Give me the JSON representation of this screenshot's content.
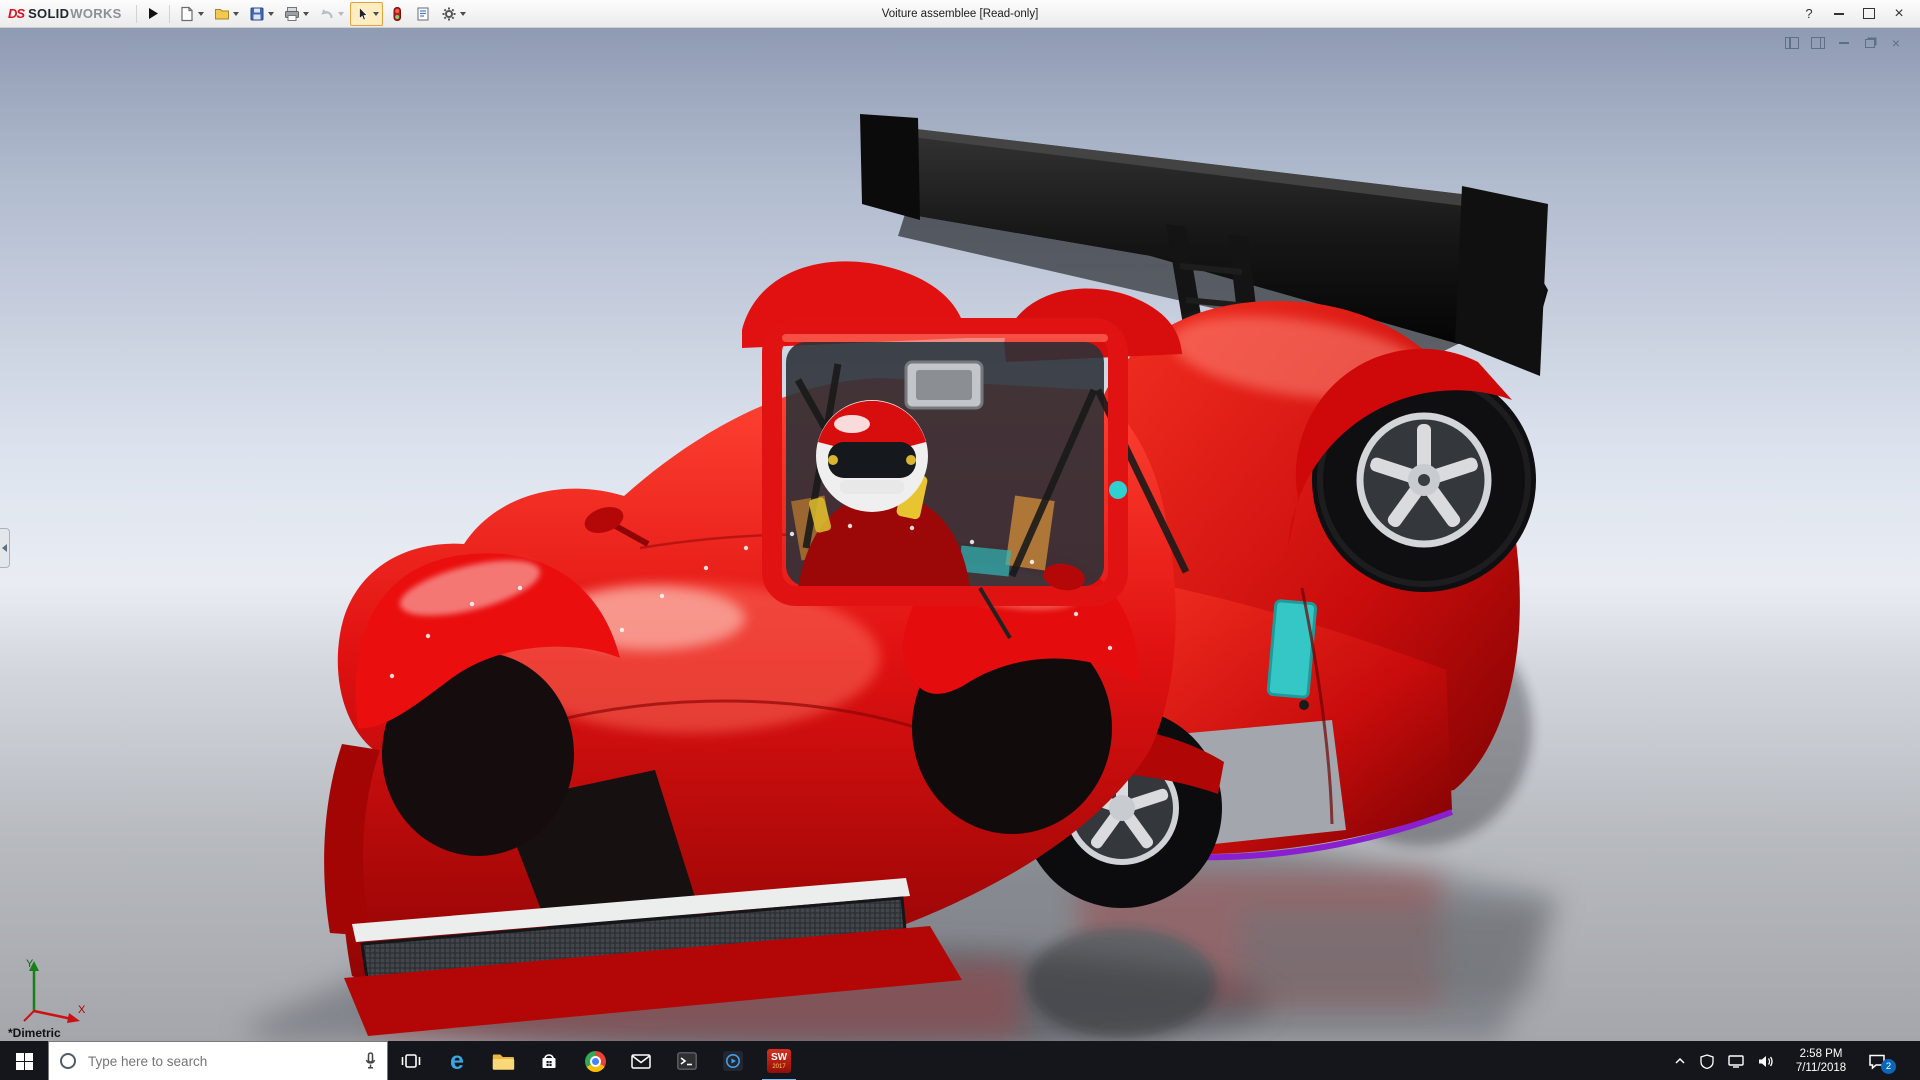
{
  "window": {
    "title": "Voiture assemblee [Read-only]",
    "help_label": "?"
  },
  "brand": {
    "mark": "DS",
    "name_bold": "SOLID",
    "name_light": "WORKS"
  },
  "toolbar": {
    "items": [
      {
        "icon": "menu-flyout-arrow-icon"
      },
      {
        "icon": "new-document-icon"
      },
      {
        "icon": "open-folder-icon"
      },
      {
        "icon": "save-icon"
      },
      {
        "icon": "print-icon"
      },
      {
        "icon": "undo-icon"
      },
      {
        "icon": "select-cursor-icon"
      },
      {
        "icon": "rebuild-icon"
      },
      {
        "icon": "file-properties-icon"
      },
      {
        "icon": "options-gear-icon"
      }
    ]
  },
  "document_window": {
    "controls": [
      "display-pane-icon",
      "feature-pane-icon",
      "minimize-icon",
      "restore-icon",
      "close-icon"
    ]
  },
  "viewport": {
    "orientation_label": "*Dimetric",
    "triad": {
      "x": "X",
      "y": "Y"
    },
    "scene_description": "red race car assembly with rear wing and driver"
  },
  "icons": {
    "edge_glyph": "e"
  },
  "taskbar": {
    "search": {
      "placeholder": "Type here to search"
    },
    "apps": [
      {
        "icon": "task-view-icon"
      },
      {
        "icon": "edge-icon"
      },
      {
        "icon": "file-explorer-icon"
      },
      {
        "icon": "store-icon"
      },
      {
        "icon": "browser-icon"
      },
      {
        "icon": "mail-icon"
      },
      {
        "icon": "terminal-icon"
      },
      {
        "icon": "media-app-icon"
      },
      {
        "icon": "solidworks-icon",
        "label_top": "SW",
        "label_bottom": "2017"
      }
    ],
    "tray": {
      "time": "2:58 PM",
      "date": "7/11/2018",
      "notification_count": "2"
    }
  }
}
